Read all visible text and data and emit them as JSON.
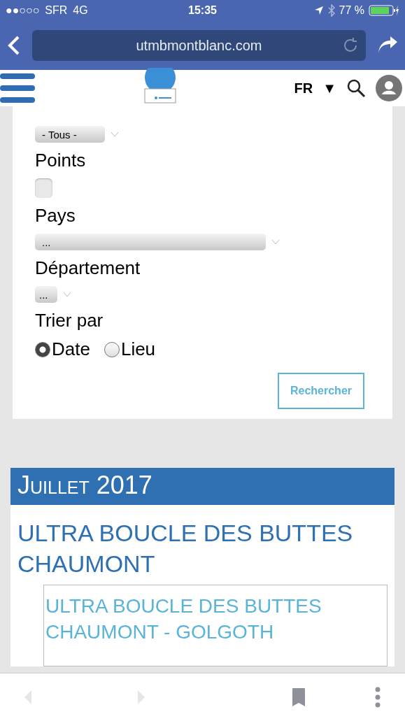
{
  "status_bar": {
    "signal": "●●○○○",
    "carrier": "SFR",
    "network": "4G",
    "time": "15:35",
    "battery": "77 %"
  },
  "browser": {
    "url": "utmbmontblanc.com"
  },
  "site_header": {
    "language": "FR",
    "caret": "▼"
  },
  "form": {
    "month_select": {
      "value": "- Tous -"
    },
    "points": {
      "label": "Points",
      "checked": false
    },
    "country": {
      "label": "Pays",
      "value": "..."
    },
    "department": {
      "label": "Département",
      "value": "..."
    },
    "sort": {
      "label": "Trier par",
      "options": [
        {
          "label": "Date",
          "selected": true
        },
        {
          "label": "Lieu",
          "selected": false
        }
      ]
    },
    "search_button": "Rechercher"
  },
  "month_header": "Juillet 2017",
  "event": {
    "title": "ULTRA BOUCLE DES BUTTES CHAUMONT",
    "race_title": "ULTRA BOUCLE DES BUTTES CHAUMONT - GOLGOTH"
  }
}
